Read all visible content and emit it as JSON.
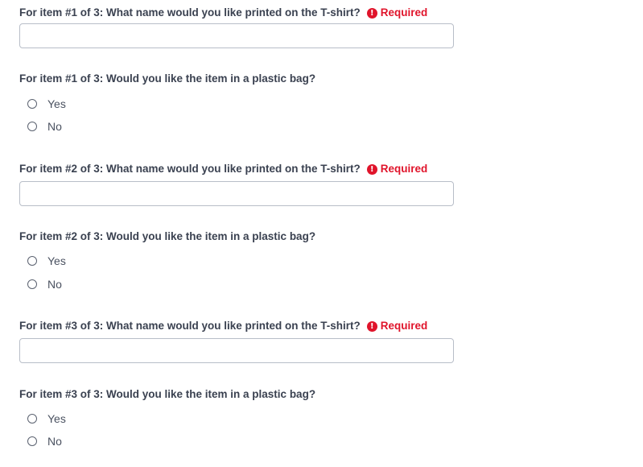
{
  "questions": [
    {
      "name_label": "For item #1 of 3: What name would you like printed on the T-shirt?",
      "required_label": "Required",
      "name_value": "",
      "bag_label": "For item #1 of 3: Would you like the item in a plastic bag?",
      "options": [
        "Yes",
        "No"
      ]
    },
    {
      "name_label": "For item #2 of 3: What name would you like printed on the T-shirt?",
      "required_label": "Required",
      "name_value": "",
      "bag_label": "For item #2 of 3: Would you like the item in a plastic bag?",
      "options": [
        "Yes",
        "No"
      ]
    },
    {
      "name_label": "For item #3 of 3: What name would you like printed on the T-shirt?",
      "required_label": "Required",
      "name_value": "",
      "bag_label": "For item #3 of 3: Would you like the item in a plastic bag?",
      "options": [
        "Yes",
        "No"
      ]
    }
  ],
  "required_icon": "exclamation-circle-icon",
  "colors": {
    "required": "#e0142b",
    "label": "#3a4150",
    "input_border": "#b8bec8"
  }
}
